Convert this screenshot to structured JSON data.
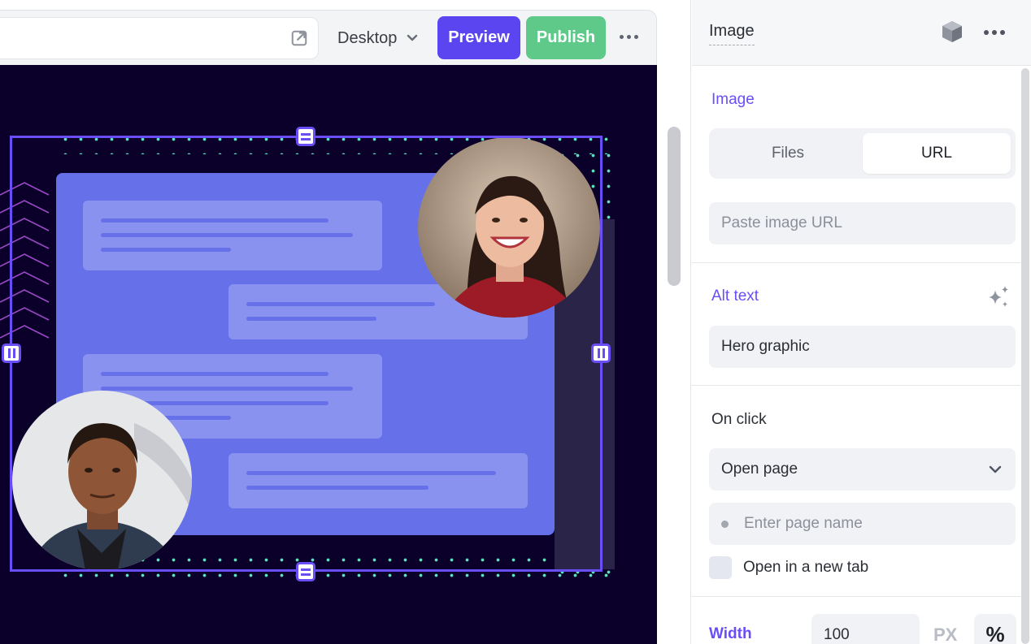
{
  "toolbar": {
    "device": "Desktop",
    "preview_label": "Preview",
    "publish_label": "Publish"
  },
  "panel": {
    "title": "Image",
    "image_section": {
      "label": "Image",
      "tabs": [
        "Files",
        "URL"
      ],
      "selected_tab": "URL",
      "url_placeholder": "Paste image URL"
    },
    "alt_text": {
      "label": "Alt text",
      "value": "Hero graphic"
    },
    "on_click": {
      "label": "On click",
      "action": "Open page",
      "page_placeholder": "Enter page name",
      "new_tab_label": "Open in a new tab",
      "new_tab_checked": false
    },
    "width": {
      "label": "Width",
      "value": "100",
      "unit_px": "PX",
      "unit_pct": "%",
      "selected_unit": "%"
    }
  },
  "icons": {
    "external_link": "external-link-icon",
    "device_dropdown": "chevron-down-icon",
    "toolbar_more": "more-horizontal-icon",
    "component": "cube-icon",
    "panel_more": "more-horizontal-icon",
    "ai_suggest": "sparkle-icon",
    "select_chevron": "chevron-down-icon"
  },
  "colors": {
    "accent": "#6a4ef5",
    "preview_button": "#5b45f0",
    "publish_button": "#5fc98a",
    "canvas_bg": "#0b0029",
    "mockup_blue": "#6670e8",
    "dot_green": "#5de3be"
  }
}
